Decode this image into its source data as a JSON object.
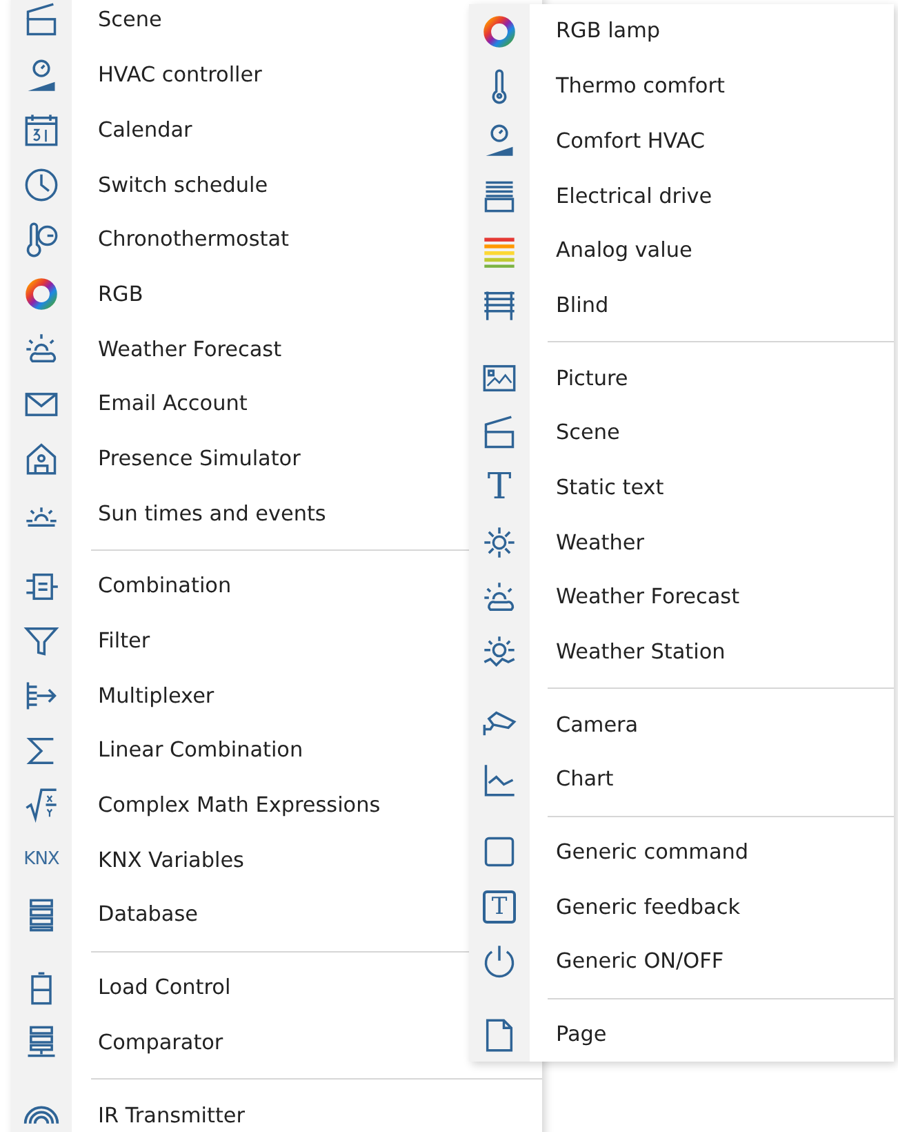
{
  "menus": [
    {
      "groups": [
        [
          {
            "label": "Scene"
          },
          {
            "label": "HVAC controller"
          },
          {
            "label": "Calendar"
          },
          {
            "label": "Switch schedule"
          },
          {
            "label": "Chronothermostat"
          },
          {
            "label": "RGB"
          },
          {
            "label": "Weather Forecast"
          },
          {
            "label": "Email Account"
          },
          {
            "label": "Presence Simulator"
          },
          {
            "label": "Sun times and events"
          }
        ],
        [
          {
            "label": "Combination"
          },
          {
            "label": "Filter"
          },
          {
            "label": "Multiplexer"
          },
          {
            "label": "Linear Combination"
          },
          {
            "label": "Complex Math Expressions"
          },
          {
            "label": "KNX Variables",
            "icon_text": "KNX"
          },
          {
            "label": "Database"
          }
        ],
        [
          {
            "label": "Load Control"
          },
          {
            "label": "Comparator"
          }
        ],
        [
          {
            "label": "IR Transmitter"
          }
        ]
      ]
    },
    {
      "groups": [
        [
          {
            "label": "RGB lamp"
          },
          {
            "label": "Thermo comfort"
          },
          {
            "label": "Comfort HVAC"
          },
          {
            "label": "Electrical drive"
          },
          {
            "label": "Analog value"
          },
          {
            "label": "Blind"
          }
        ],
        [
          {
            "label": "Picture"
          },
          {
            "label": "Scene"
          },
          {
            "label": "Static text",
            "icon_text": "T"
          },
          {
            "label": "Weather"
          },
          {
            "label": "Weather Forecast"
          },
          {
            "label": "Weather Station"
          }
        ],
        [
          {
            "label": "Camera"
          },
          {
            "label": "Chart"
          }
        ],
        [
          {
            "label": "Generic command"
          },
          {
            "label": "Generic feedback",
            "icon_text": "T"
          },
          {
            "label": "Generic ON/OFF"
          }
        ],
        [
          {
            "label": "Page"
          }
        ]
      ]
    }
  ]
}
